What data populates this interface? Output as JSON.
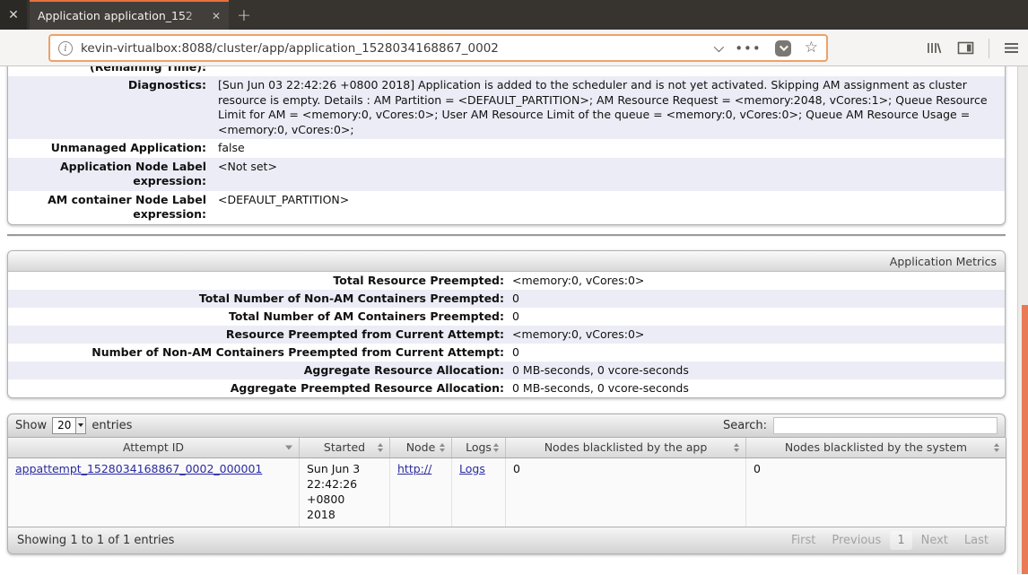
{
  "colors": {
    "accent_orange": "#e8703a",
    "scrollbar_thumb": "#e87a55",
    "row_stripe": "#ececf6",
    "link": "#2b2ba0"
  },
  "browser": {
    "window_close_glyph": "✕",
    "tab_title": "Application application_152",
    "tab_close_glyph": "✕",
    "new_tab_glyph": "+",
    "info_icon_glyph": "i",
    "url": "kevin-virtualbox:8088/cluster/app/application_1528034168867_0002",
    "overflow_dots_glyph": "•••",
    "star_glyph": "☆"
  },
  "info_table": {
    "partial_label": "(Remaining Time):",
    "rows": [
      {
        "label": "Diagnostics:",
        "value": "[Sun Jun 03 22:42:26 +0800 2018] Application is added to the scheduler and is not yet activated. Skipping AM assignment as cluster resource is empty. Details : AM Partition = <DEFAULT_PARTITION>; AM Resource Request = <memory:2048, vCores:1>; Queue Resource Limit for AM = <memory:0, vCores:0>; User AM Resource Limit of the queue = <memory:0, vCores:0>; Queue AM Resource Usage = <memory:0, vCores:0>;"
      },
      {
        "label": "Unmanaged Application:",
        "value": "false"
      },
      {
        "label": "Application Node Label expression:",
        "value": "<Not set>"
      },
      {
        "label": "AM container Node Label expression:",
        "value": "<DEFAULT_PARTITION>"
      }
    ]
  },
  "metrics": {
    "header_label": "Application Metrics",
    "rows": [
      {
        "label": "Total Resource Preempted:",
        "value": "<memory:0, vCores:0>"
      },
      {
        "label": "Total Number of Non-AM Containers Preempted:",
        "value": "0"
      },
      {
        "label": "Total Number of AM Containers Preempted:",
        "value": "0"
      },
      {
        "label": "Resource Preempted from Current Attempt:",
        "value": "<memory:0, vCores:0>"
      },
      {
        "label": "Number of Non-AM Containers Preempted from Current Attempt:",
        "value": "0"
      },
      {
        "label": "Aggregate Resource Allocation:",
        "value": "0 MB-seconds, 0 vcore-seconds"
      },
      {
        "label": "Aggregate Preempted Resource Allocation:",
        "value": "0 MB-seconds, 0 vcore-seconds"
      }
    ]
  },
  "attempts": {
    "show_label": "Show",
    "page_size": "20",
    "entries_label": "entries",
    "search_label": "Search:",
    "columns": [
      {
        "label": "Attempt ID"
      },
      {
        "label": "Started"
      },
      {
        "label": "Node"
      },
      {
        "label": "Logs"
      },
      {
        "label": "Nodes blacklisted by the app"
      },
      {
        "label": "Nodes blacklisted by the system"
      }
    ],
    "row": {
      "attempt_id": "appattempt_1528034168867_0002_000001",
      "started": "Sun Jun 3 22:42:26 +0800 2018",
      "node": "http://",
      "logs": "Logs",
      "app_blacklisted": "0",
      "system_blacklisted": "0"
    },
    "footer_text": "Showing 1 to 1 of 1 entries",
    "pagination": [
      "First",
      "Previous",
      "1",
      "Next",
      "Last"
    ]
  }
}
